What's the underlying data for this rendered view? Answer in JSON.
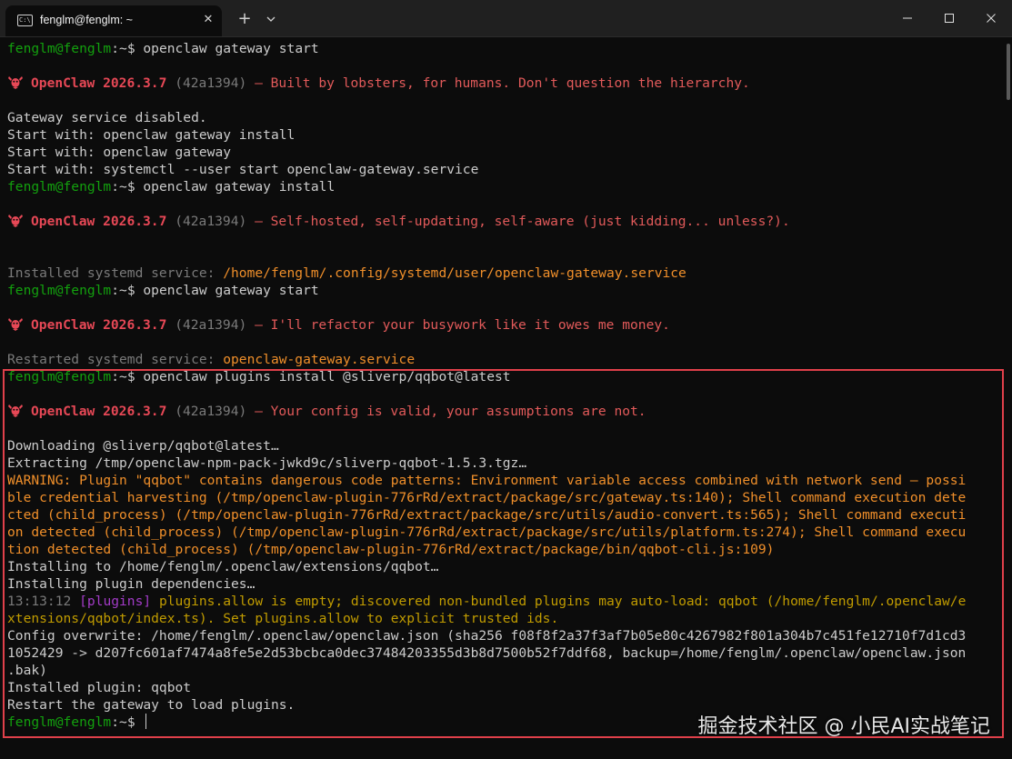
{
  "window": {
    "tab_title": "fenglm@fenglm: ~",
    "tab_icon": "terminal-icon",
    "new_tab_symbol": "+",
    "close_symbol": "✕"
  },
  "prompt": {
    "user": "fenglm@fenglm",
    "sep": ":~",
    "sym": "$ "
  },
  "lines": [
    {
      "t": "p",
      "cmd": "openclaw gateway start"
    },
    {
      "t": "blank"
    },
    {
      "t": "b",
      "ver": "2026.3.7",
      "hash": "(42a1394)",
      "msg": "— Built by lobsters, for humans. Don't question the hierarchy."
    },
    {
      "t": "blank"
    },
    {
      "t": "s",
      "c": "w",
      "x": "Gateway service disabled."
    },
    {
      "t": "s",
      "c": "w",
      "x": "Start with: openclaw gateway install"
    },
    {
      "t": "s",
      "c": "w",
      "x": "Start with: openclaw gateway"
    },
    {
      "t": "s",
      "c": "w",
      "x": "Start with: systemctl --user start openclaw-gateway.service"
    },
    {
      "t": "p",
      "cmd": "openclaw gateway install"
    },
    {
      "t": "blank"
    },
    {
      "t": "b",
      "ver": "2026.3.7",
      "hash": "(42a1394)",
      "msg": "— Self-hosted, self-updating, self-aware (just kidding... unless?)."
    },
    {
      "t": "blank"
    },
    {
      "t": "blank"
    },
    {
      "t": "kv",
      "k": "Installed systemd service: ",
      "v": "/home/fenglm/.config/systemd/user/openclaw-gateway.service"
    },
    {
      "t": "p",
      "cmd": "openclaw gateway start"
    },
    {
      "t": "blank"
    },
    {
      "t": "b",
      "ver": "2026.3.7",
      "hash": "(42a1394)",
      "msg": "— I'll refactor your busywork like it owes me money."
    },
    {
      "t": "blank"
    },
    {
      "t": "kv",
      "k": "Restarted systemd service: ",
      "v": "openclaw-gateway.service"
    },
    {
      "t": "p",
      "cmd": "openclaw plugins install @sliverp/qqbot@latest"
    },
    {
      "t": "blank"
    },
    {
      "t": "b",
      "ver": "2026.3.7",
      "hash": "(42a1394)",
      "msg": "— Your config is valid, your assumptions are not."
    },
    {
      "t": "blank"
    },
    {
      "t": "s",
      "c": "w",
      "x": "Downloading @sliverp/qqbot@latest…"
    },
    {
      "t": "s",
      "c": "w",
      "x": "Extracting /tmp/openclaw-npm-pack-jwkd9c/sliverp-qqbot-1.5.3.tgz…"
    },
    {
      "t": "s",
      "c": "o",
      "x": "WARNING: Plugin \"qqbot\" contains dangerous code patterns: Environment variable access combined with network send — possi"
    },
    {
      "t": "s",
      "c": "o",
      "x": "ble credential harvesting (/tmp/openclaw-plugin-776rRd/extract/package/src/gateway.ts:140); Shell command execution dete"
    },
    {
      "t": "s",
      "c": "o",
      "x": "cted (child_process) (/tmp/openclaw-plugin-776rRd/extract/package/src/utils/audio-convert.ts:565); Shell command executi"
    },
    {
      "t": "s",
      "c": "o",
      "x": "on detected (child_process) (/tmp/openclaw-plugin-776rRd/extract/package/src/utils/platform.ts:274); Shell command execu"
    },
    {
      "t": "s",
      "c": "o",
      "x": "tion detected (child_process) (/tmp/openclaw-plugin-776rRd/extract/package/bin/qqbot-cli.js:109)"
    },
    {
      "t": "s",
      "c": "w",
      "x": "Installing to /home/fenglm/.openclaw/extensions/qqbot…"
    },
    {
      "t": "s",
      "c": "w",
      "x": "Installing plugin dependencies…"
    },
    {
      "t": "log",
      "time": "13:13:12",
      "tag": "[plugins]",
      "msg": "plugins.allow is empty; discovered non-bundled plugins may auto-load: qqbot (/home/fenglm/.openclaw/e"
    },
    {
      "t": "s",
      "c": "y",
      "x": "xtensions/qqbot/index.ts). Set plugins.allow to explicit trusted ids."
    },
    {
      "t": "s",
      "c": "w",
      "x": "Config overwrite: /home/fenglm/.openclaw/openclaw.json (sha256 f08f8f2a37f3af7b05e80c4267982f801a304b7c451fe12710f7d1cd3"
    },
    {
      "t": "s",
      "c": "w",
      "x": "1052429 -> d207fc601af7474a8fe5e2d53bcbca0dec37484203355d3b8d7500b52f7ddf68, backup=/home/fenglm/.openclaw/openclaw.json"
    },
    {
      "t": "s",
      "c": "w",
      "x": ".bak)"
    },
    {
      "t": "s",
      "c": "w",
      "x": "Installed plugin: qqbot"
    },
    {
      "t": "s",
      "c": "w",
      "x": "Restart the gateway to load plugins."
    },
    {
      "t": "p",
      "cmd": "",
      "cursor": true
    }
  ],
  "brand": "OpenClaw",
  "watermark": "掘金技术社区 @ 小民AI实战笔记",
  "colors": {
    "prompt_green": "#13a10e",
    "brand_red": "#e74856",
    "warning_orange": "#f08f2a",
    "log_yellow": "#c19c00",
    "highlight_border": "#e0404a"
  }
}
